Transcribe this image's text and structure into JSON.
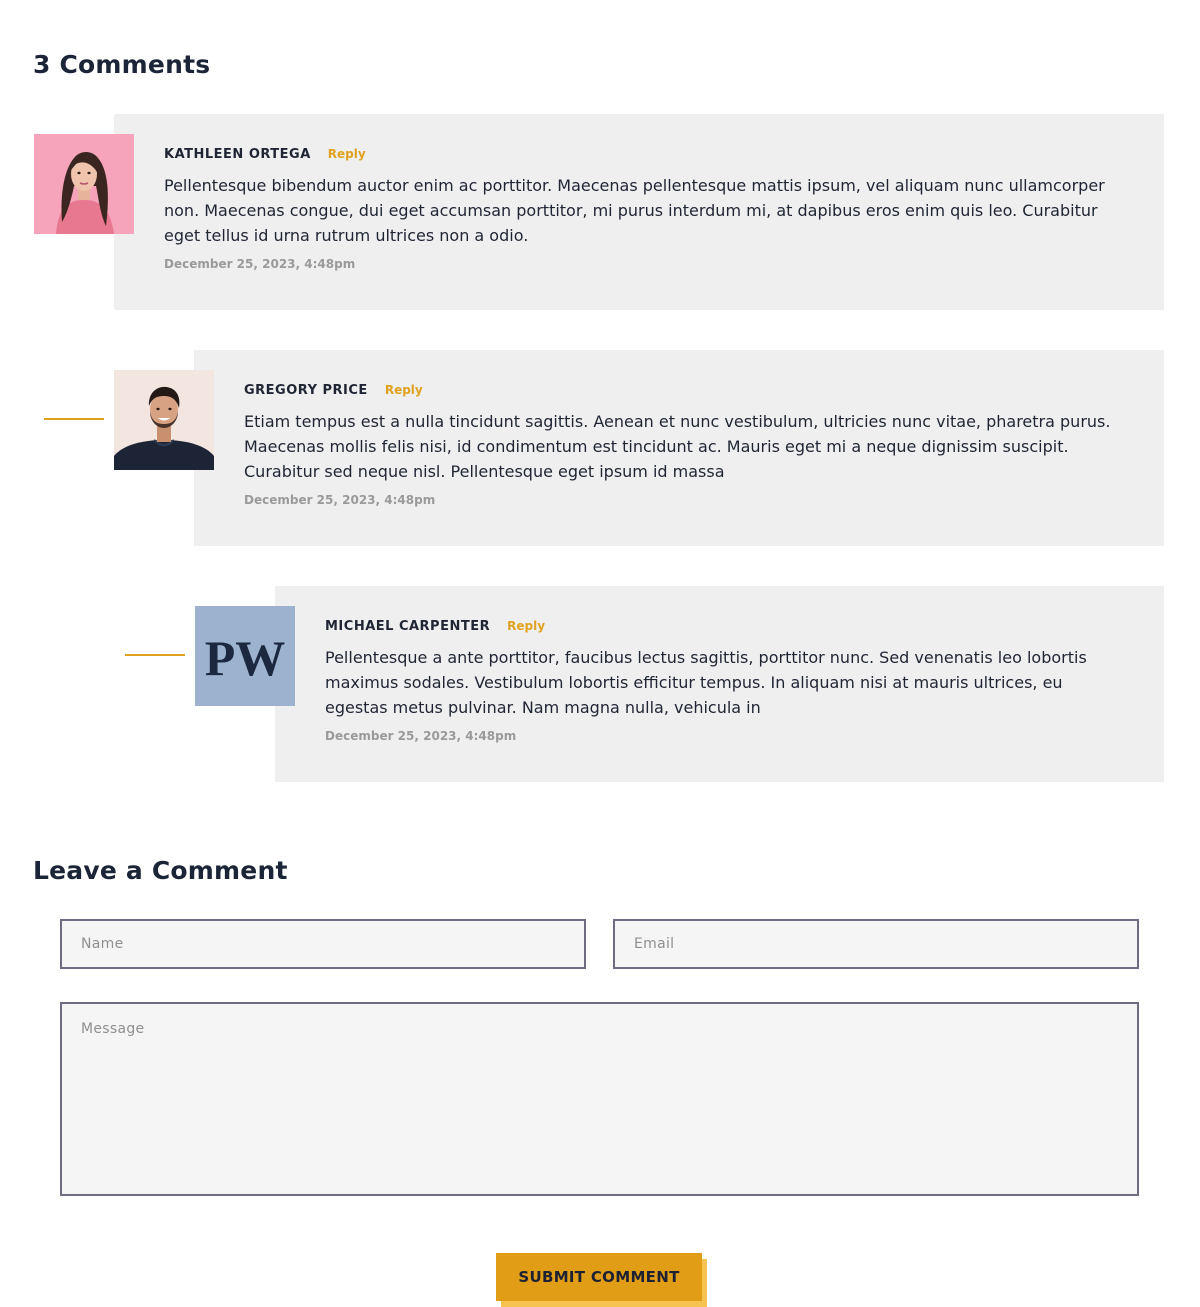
{
  "comments_section": {
    "heading": "3 Comments",
    "comments": [
      {
        "author": "KATHLEEN ORTEGA",
        "reply_label": "Reply",
        "text": "Pellentesque bibendum auctor enim ac porttitor. Maecenas pellentesque mattis ipsum, vel aliquam nunc ullamcorper non. Maecenas congue, dui eget accumsan porttitor, mi purus interdum mi, at dapibus eros enim quis leo. Curabitur eget tellus id urna rutrum ultrices non a odio.",
        "date": "December 25, 2023, 4:48pm",
        "avatar_icon": "woman-portrait"
      },
      {
        "author": "GREGORY PRICE",
        "reply_label": "Reply",
        "text": "Etiam tempus est a nulla tincidunt sagittis. Aenean et nunc vestibulum, ultricies nunc vitae, pharetra purus. Maecenas mollis felis nisi, id condimentum est tincidunt ac. Mauris eget mi a neque dignissim suscipit. Curabitur sed neque nisl. Pellentesque eget ipsum id massa",
        "date": "December 25, 2023, 4:48pm",
        "avatar_icon": "man-portrait"
      },
      {
        "author": "MICHAEL CARPENTER",
        "reply_label": "Reply",
        "text": "Pellentesque a ante porttitor, faucibus lectus sagittis, porttitor nunc. Sed venenatis leo lobortis maximus sodales. Vestibulum lobortis efficitur tempus. In aliquam nisi at mauris ultrices, eu egestas metus pulvinar. Nam magna nulla, vehicula in",
        "date": "December 25, 2023, 4:48pm",
        "avatar_icon": "pw-logo",
        "avatar_logo_text": "PW"
      }
    ]
  },
  "comment_form": {
    "heading": "Leave a Comment",
    "name_placeholder": "Name",
    "email_placeholder": "Email",
    "message_placeholder": "Message",
    "submit_label": "SUBMIT COMMENT"
  },
  "colors": {
    "accent": "#e29d17",
    "accent_light": "#f6c350",
    "comment_background": "#efefef",
    "heading": "#1c2538",
    "date": "#9a9a9a"
  }
}
